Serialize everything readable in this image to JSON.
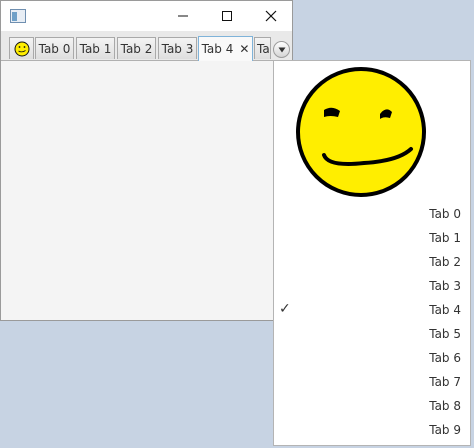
{
  "window": {
    "controls": {
      "minimize": "—",
      "maximize": "☐",
      "close": "✕"
    }
  },
  "tabs": [
    {
      "label": "",
      "icon": "smiley-face-icon"
    },
    {
      "label": "Tab 0"
    },
    {
      "label": "Tab 1"
    },
    {
      "label": "Tab 2"
    },
    {
      "label": "Tab 3"
    },
    {
      "label": "Tab 4",
      "selected": true,
      "close": "✕"
    },
    {
      "label": "Ta"
    }
  ],
  "overflow_menu": {
    "header_icon": "smiley-face-icon",
    "check_mark": "✓",
    "items": [
      "Tab 0",
      "Tab 1",
      "Tab 2",
      "Tab 3",
      "Tab 4",
      "Tab 5",
      "Tab 6",
      "Tab 7",
      "Tab 8",
      "Tab 9"
    ],
    "selected_index": 4
  },
  "colors": {
    "smiley_fill": "#ffee00",
    "selected_tab_border": "#7fb3d9"
  }
}
